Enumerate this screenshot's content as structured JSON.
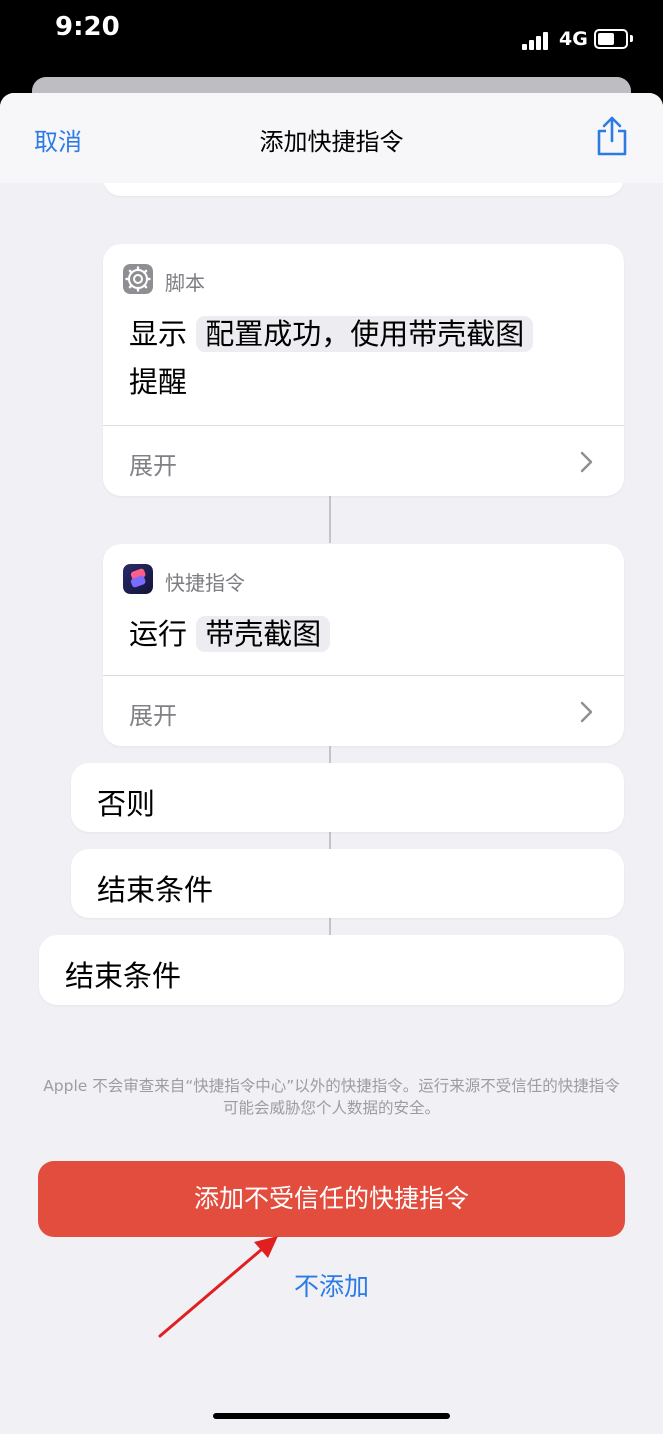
{
  "status_bar": {
    "time": "9:20",
    "network": "4G"
  },
  "nav": {
    "cancel_label": "取消",
    "title": "添加快捷指令",
    "share_icon": "share-icon"
  },
  "actions": [
    {
      "app_label": "脚本",
      "app_icon": "gear-icon",
      "verb": "显示",
      "token": "配置成功，使用带壳截图",
      "suffix": "提醒",
      "expand_label": "展开"
    },
    {
      "app_label": "快捷指令",
      "app_icon": "shortcuts-icon",
      "verb": "运行",
      "token": "带壳截图",
      "expand_label": "展开"
    }
  ],
  "blocks": {
    "otherwise": "否则",
    "end_if_inner": "结束条件",
    "end_if_outer": "结束条件"
  },
  "disclaimer": "Apple 不会审查来自“快捷指令中心”以外的快捷指令。运行来源不受信任的快捷指令可能会威胁您个人数据的安全。",
  "buttons": {
    "add_untrusted": "添加不受信任的快捷指令",
    "dont_add": "不添加"
  },
  "colors": {
    "accent_blue": "#2c7be5",
    "danger_red": "#e34d3e",
    "annotation_arrow": "#e02020",
    "sheet_bg": "#f0f0f5"
  }
}
